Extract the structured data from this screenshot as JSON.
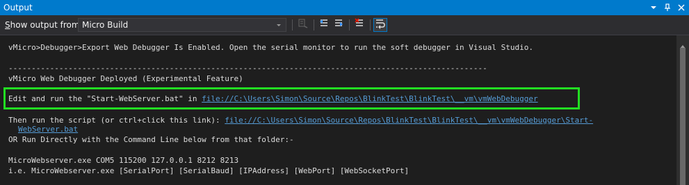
{
  "window": {
    "title": "Output",
    "accent_color": "#007acc",
    "icons": [
      "chevron-down-icon",
      "pin-icon",
      "close-icon"
    ]
  },
  "toolbar": {
    "show_output_label_prefix": "S",
    "show_output_label_rest": "how output from:",
    "source_selected": "Micro Build",
    "buttons": [
      "find-message-icon",
      "go-to-previous-icon",
      "go-to-next-icon",
      "clear-all-icon",
      "toggle-word-wrap-icon"
    ]
  },
  "output": {
    "line1": "vMicro>Debugger>Export Web Debugger Is Enabled. Open the serial monitor to run the soft debugger in Visual Studio.",
    "separator": "--------------------------------------------------------------------------------------------------------",
    "line3": "vMicro Web Debugger Deployed (Experimental Feature)",
    "line4_text": "Edit and run the \"Start-WebServer.bat\" in ",
    "line4_link": "file://C:\\Users\\Simon\\Source\\Repos\\BlinkTest\\BlinkTest\\__vm\\vmWebDebugger",
    "line5_text": "Then run the script (or ctrl+click this link): ",
    "line5_link": "file://C:\\Users\\Simon\\Source\\Repos\\BlinkTest\\BlinkTest\\__vm\\vmWebDebugger\\Start-",
    "line5_link_cont": "WebServer.bat",
    "line6": "OR Run Directly with the Command Line below from that folder:-",
    "line7": "MicroWebserver.exe COM5 115200 127.0.0.1 8212 8213",
    "line8": "i.e. MicroWebserver.exe [SerialPort] [SerialBaud] [IPAddress] [WebPort] [WebSocketPort]",
    "highlight_color": "#22dd22",
    "link_color": "#569cd6"
  }
}
